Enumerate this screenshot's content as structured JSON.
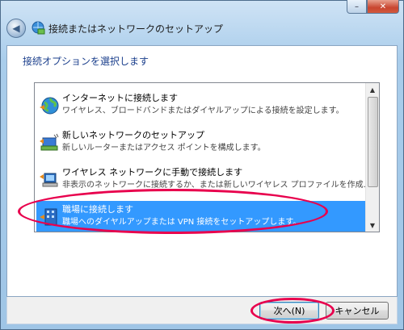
{
  "window": {
    "title": "接続またはネットワークのセットアップ",
    "close_label": "✕",
    "minimize_label": "–"
  },
  "subtitle": "接続オプションを選択します",
  "options": [
    {
      "title": "インターネットに接続します",
      "description": "ワイヤレス、ブロードバンドまたはダイヤルアップによる接続を設定します。",
      "icon": "globe-icon",
      "selected": false
    },
    {
      "title": "新しいネットワークのセットアップ",
      "description": "新しいルーターまたはアクセス ポイントを構成します。",
      "icon": "router-icon",
      "selected": false
    },
    {
      "title": "ワイヤレス ネットワークに手動で接続します",
      "description": "非表示のネットワークに接続するか、または新しいワイヤレス プロファイルを作成...",
      "icon": "wireless-icon",
      "selected": false
    },
    {
      "title": "職場に接続します",
      "description": "職場へのダイヤルアップまたは VPN 接続をセットアップします。",
      "icon": "workplace-icon",
      "selected": true
    }
  ],
  "buttons": {
    "next": "次へ(N)",
    "cancel": "キャンセル"
  },
  "colors": {
    "selection": "#3399ff",
    "highlight_ring": "#e8004d",
    "subtitle": "#1b3f8c"
  }
}
